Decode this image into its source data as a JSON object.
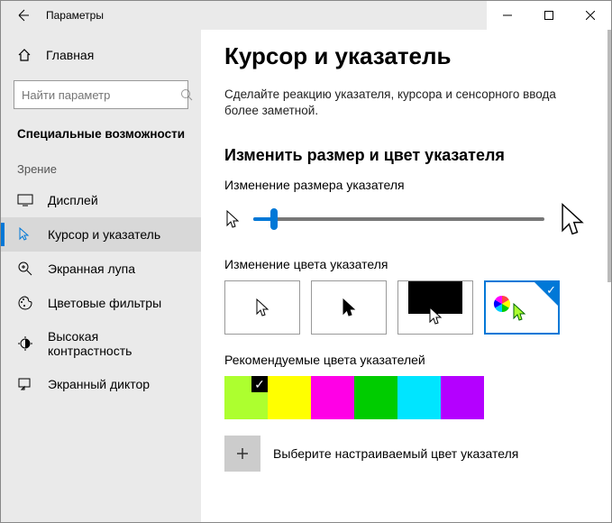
{
  "window": {
    "title": "Параметры"
  },
  "sidebar": {
    "home": "Главная",
    "search_placeholder": "Найти параметр",
    "group": "Специальные возможности",
    "section": "Зрение",
    "items": [
      {
        "label": "Дисплей"
      },
      {
        "label": "Курсор и указатель"
      },
      {
        "label": "Экранная лупа"
      },
      {
        "label": "Цветовые фильтры"
      },
      {
        "label": "Высокая контрастность"
      },
      {
        "label": "Экранный диктор"
      }
    ]
  },
  "page": {
    "heading": "Курсор и указатель",
    "desc": "Сделайте реакцию указателя, курсора и сенсорного ввода более заметной.",
    "section_title": "Изменить размер и цвет указателя",
    "size_label": "Изменение размера указателя",
    "color_label": "Изменение цвета указателя",
    "recommended_label": "Рекомендуемые цвета указателей",
    "custom_label": "Выберите настраиваемый цвет указателя",
    "slider_percent": 7,
    "pointer_options": [
      "white",
      "black",
      "inverted",
      "custom"
    ],
    "pointer_selected": 3,
    "swatches": [
      "#ADFF2F",
      "#FFFF00",
      "#FF00E6",
      "#00CC00",
      "#00E5FF",
      "#B400FF"
    ],
    "swatch_selected": 0
  }
}
